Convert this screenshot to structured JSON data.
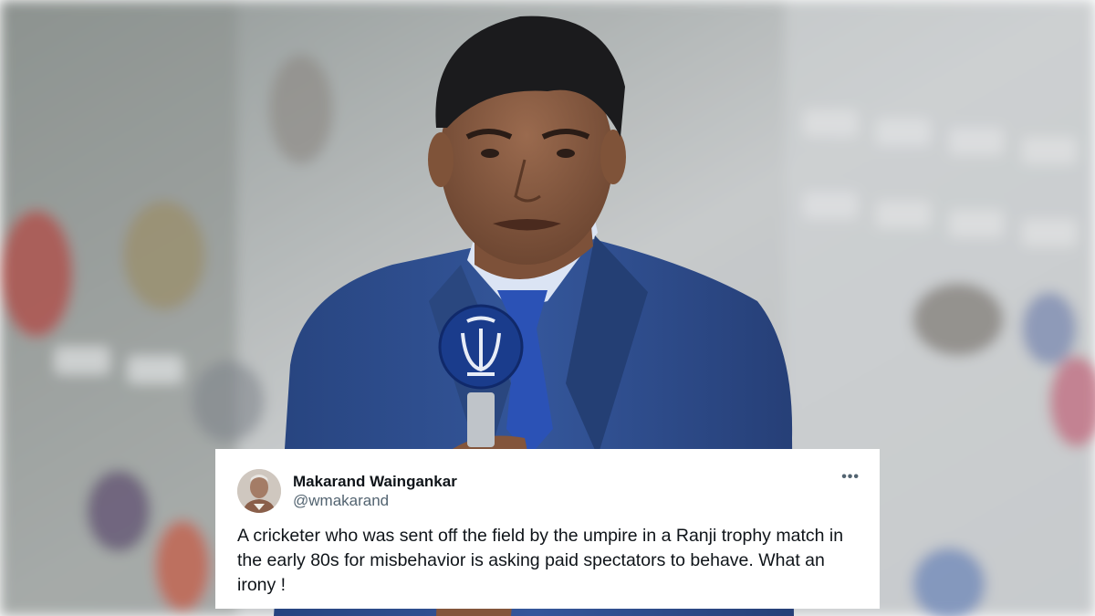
{
  "tweet": {
    "author_name": "Makarand Waingankar",
    "author_handle": "@wmakarand",
    "more_label": "•••",
    "text": "A cricketer who was sent off the field by the umpire in a Ranji trophy match in the early 80s for misbehavior is asking paid spectators to behave. What an irony  !"
  },
  "colors": {
    "suit": "#2f4f8e",
    "tie": "#2b52b6",
    "shirt": "#dbe4f4",
    "microphone": "#1a3c8c",
    "stadium_seats": "#cfd3d6"
  }
}
